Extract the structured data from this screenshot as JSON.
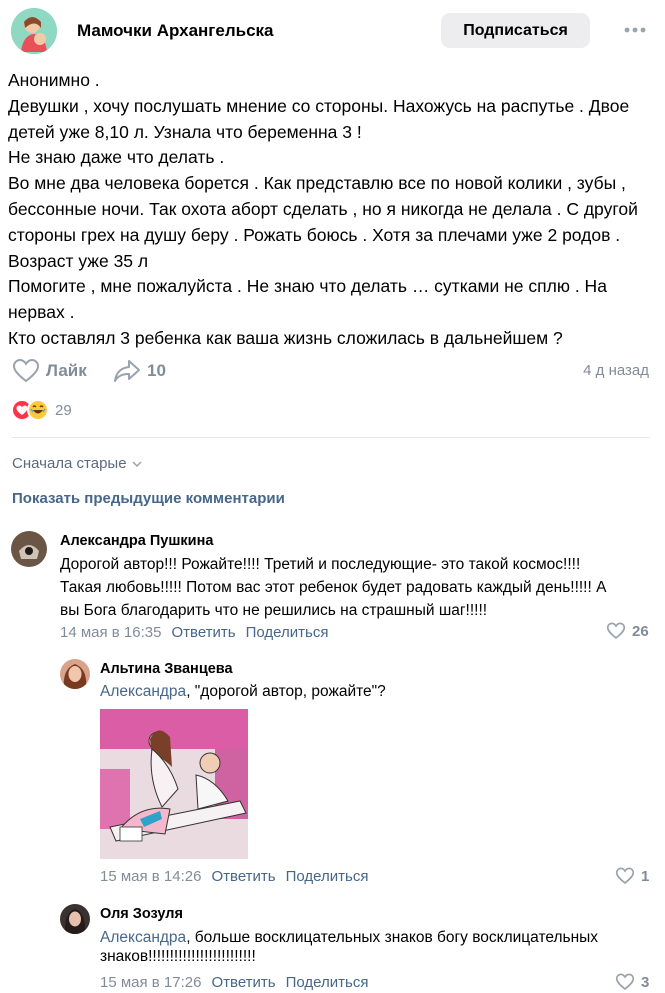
{
  "header": {
    "group_name": "Мамочки Архангельска",
    "subscribe_label": "Подписаться",
    "more_icon": "more-horizontal-icon"
  },
  "post": {
    "lines": [
      "Анонимно .",
      "Девушки , хочу послушать мнение со стороны. Нахожусь на распутье . Двое",
      "детей уже 8,10 л. Узнала что беременна 3 !",
      "Не знаю даже что делать .",
      "Во мне два человека борется . Как представлю все по новой колики , зубы ,",
      "бессонные ночи. Так охота аборт сделать , но я никогда не делала . С другой",
      "стороны грех на душу беру . Рожать боюсь . Хотя за плечами уже 2 родов .",
      "Возраст уже 35 л",
      "Помогите , мне пожалуйста . Не знаю что делать … сутками не сплю . На",
      "нервах .",
      "Кто оставлял 3 ребенка как ваша жизнь сложилась в дальнейшем ?"
    ],
    "like_label": "Лайк",
    "share_count": "10",
    "time": "4 д назад",
    "reactions_count": "29"
  },
  "comments_section": {
    "sort_label": "Сначала старые",
    "show_previous_label": "Показать предыдущие комментарии"
  },
  "comments": [
    {
      "author": "Александра Пушкина",
      "lines": [
        "Дорогой автор!!! Рожайте!!!! Третий и последующие- это такой космос!!!!",
        "Такая любовь!!!!! Потом вас этот ребенок будет радовать каждый день!!!!! А",
        "вы Бога благодарить что не решились на страшный шаг!!!!!"
      ],
      "date": "14 мая в 16:35",
      "reply_label": "Ответить",
      "share_label": "Поделиться",
      "likes": "26"
    },
    {
      "author": "Альтина Званцева",
      "mention": "Александра",
      "text": ", \"дорогой автор, рожайте\"?",
      "date": "15 мая в 14:26",
      "reply_label": "Ответить",
      "share_label": "Поделиться",
      "likes": "1"
    },
    {
      "author": "Оля Зозуля",
      "mention": "Александра",
      "line1": ", больше восклицательных знаков богу восклицательных",
      "line2": "знаков!!!!!!!!!!!!!!!!!!!!!!!!!",
      "date": "15 мая в 17:26",
      "reply_label": "Ответить",
      "share_label": "Поделиться",
      "likes": "3"
    }
  ]
}
